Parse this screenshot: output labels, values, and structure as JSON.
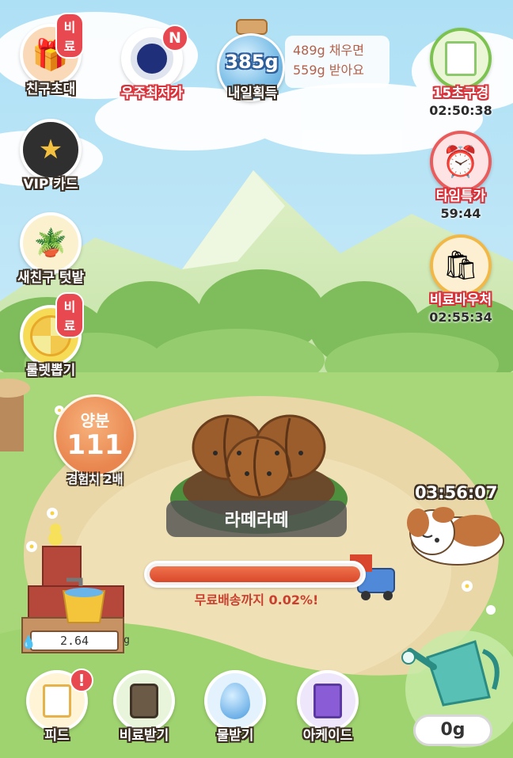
{
  "top_left": {
    "invite": {
      "label": "친구초대",
      "badge": "비료",
      "icon": "gift-chest-icon"
    },
    "space_price": {
      "label": "우주최저가",
      "badge": "N",
      "icon": "astronaut-helmet-icon"
    },
    "vip": {
      "label": "VIP 카드",
      "icon": "star-hexagon-icon"
    },
    "new_friend": {
      "label": "새친구 텃밭",
      "icon": "potted-sprout-icon"
    },
    "roulette": {
      "label": "룰렛뽑기",
      "badge": "비료",
      "icon": "roulette-icon"
    }
  },
  "tomorrow": {
    "amount": "385g",
    "label": "내일획득",
    "info_line1": "489g 채우면",
    "info_line2": "559g 받아요"
  },
  "right_menu": {
    "seed_15": {
      "label": "15초구경",
      "timer": "02:50:38",
      "icon": "seed-packs-icon"
    },
    "time_sale": {
      "label": "타임특가",
      "timer": "59:44",
      "icon": "alarm-clock-icon"
    },
    "voucher": {
      "label": "비료바우처",
      "timer": "02:55:34",
      "icon": "shopping-bag-icon"
    }
  },
  "nutrient": {
    "title": "양분",
    "value": "111",
    "sub": "경험치 2배"
  },
  "plant": {
    "name": "라떼라떼"
  },
  "delivery": {
    "progress_percent": 0.02,
    "text": "무료배송까지 0.02%!"
  },
  "dog": {
    "timer": "03:56:07"
  },
  "water_tank": {
    "value": "2.64",
    "unit": "g"
  },
  "bottom_nav": [
    {
      "label": "피드",
      "icon": "feed-icon",
      "badge": "!"
    },
    {
      "label": "비료받기",
      "icon": "fertilizer-bag-icon"
    },
    {
      "label": "물받기",
      "icon": "water-drop-icon"
    },
    {
      "label": "아케이드",
      "icon": "arcade-machine-icon"
    }
  ],
  "watering_can": {
    "amount": "0g"
  },
  "colors": {
    "accent_red": "#e8484f",
    "progress_red": "#d9482a",
    "sky": "#bfe6f7",
    "grass": "#9bd06a"
  }
}
